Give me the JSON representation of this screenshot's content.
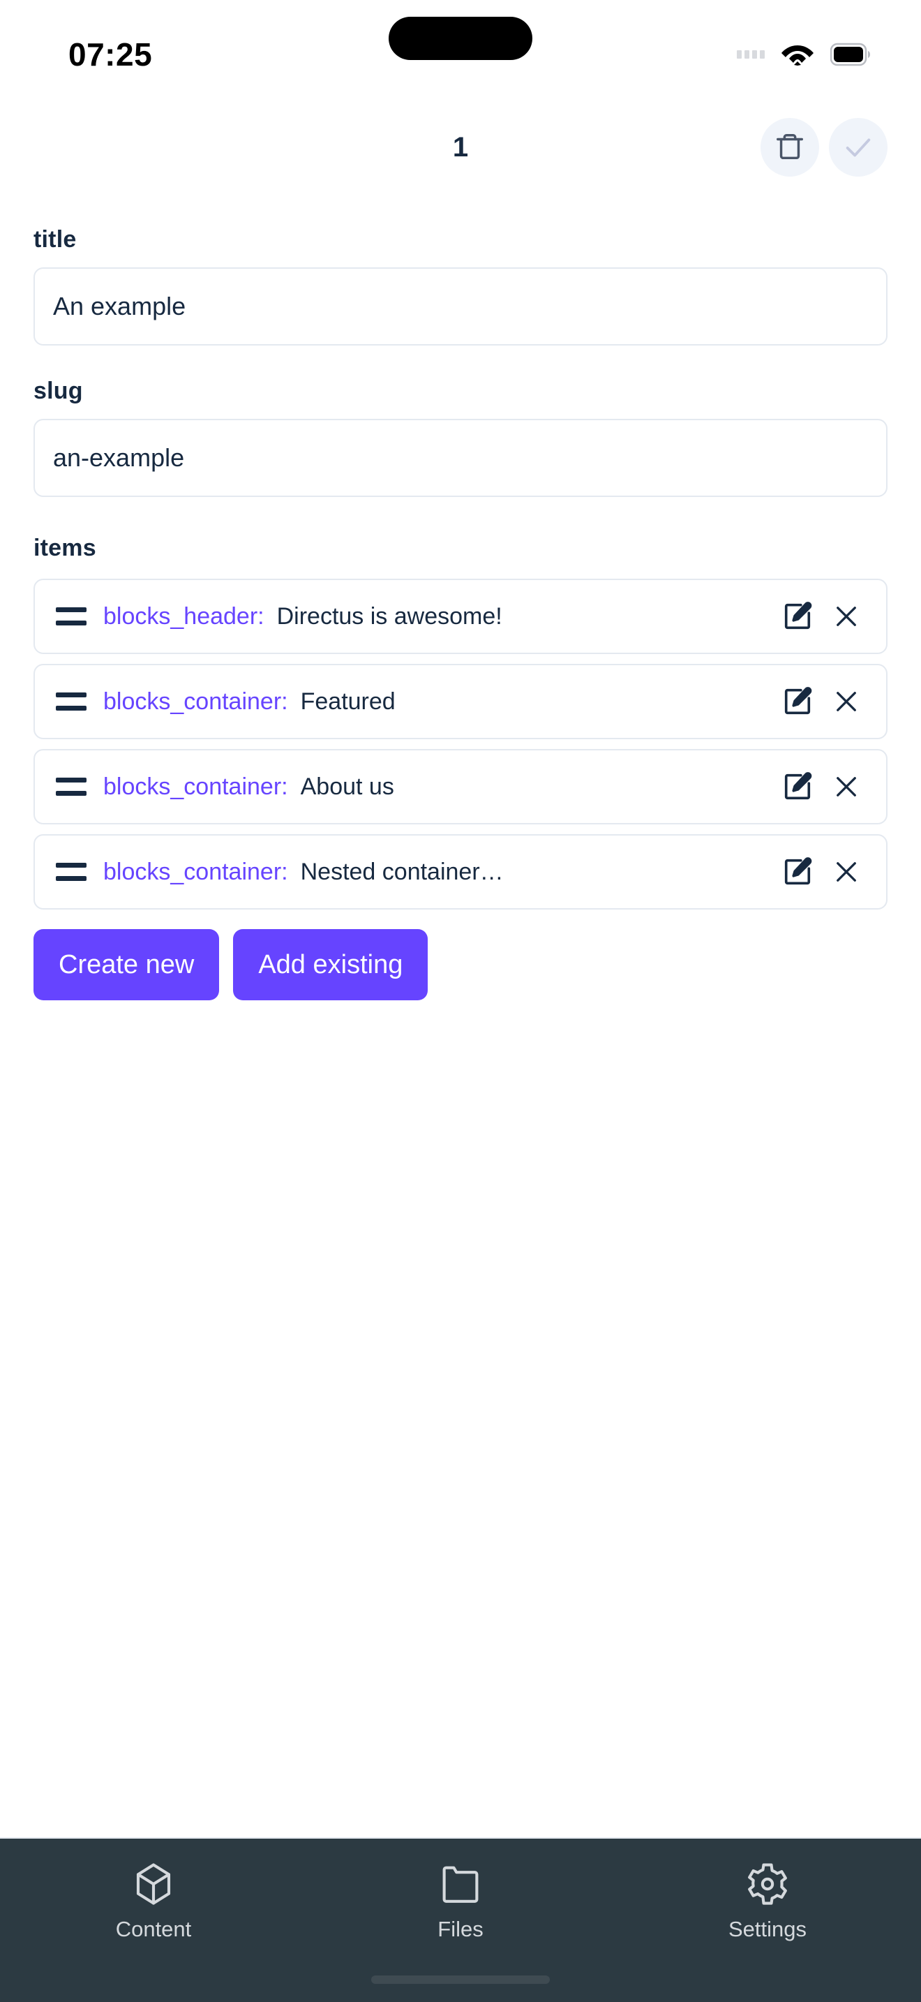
{
  "status_bar": {
    "time": "07:25",
    "icons": {
      "signal": "signal-dots-icon",
      "wifi": "wifi-icon",
      "battery": "battery-icon"
    }
  },
  "header": {
    "title": "1",
    "delete_icon": "trash-icon",
    "save_icon": "check-icon",
    "button_bg": "#f0f4fa",
    "save_icon_color": "#c5cae0",
    "delete_icon_color": "#4a5568"
  },
  "form": {
    "fields": [
      {
        "label": "title",
        "value": "An example",
        "placeholder": ""
      },
      {
        "label": "slug",
        "value": "an-example",
        "placeholder": ""
      }
    ],
    "items_label": "items",
    "items": [
      {
        "collection": "blocks_header:",
        "value": "Directus is awesome!",
        "edit_icon": "edit-square-icon",
        "remove_icon": "close-icon"
      },
      {
        "collection": "blocks_container:",
        "value": "Featured",
        "edit_icon": "edit-square-icon",
        "remove_icon": "close-icon"
      },
      {
        "collection": "blocks_container:",
        "value": "About us",
        "edit_icon": "edit-square-icon",
        "remove_icon": "close-icon"
      },
      {
        "collection": "blocks_container:",
        "value": "Nested container…",
        "edit_icon": "edit-square-icon",
        "remove_icon": "close-icon"
      }
    ],
    "buttons": {
      "create_new": "Create new",
      "add_existing": "Add existing"
    },
    "accent_color": "#6644ff",
    "label_color": "#172940",
    "border_color": "#e4e9f0"
  },
  "bottom_nav": {
    "background": "#2c3a42",
    "icon_color": "#d5d9dd",
    "items": [
      {
        "label": "Content",
        "icon": "box-icon"
      },
      {
        "label": "Files",
        "icon": "folder-icon"
      },
      {
        "label": "Settings",
        "icon": "gear-icon"
      }
    ]
  }
}
